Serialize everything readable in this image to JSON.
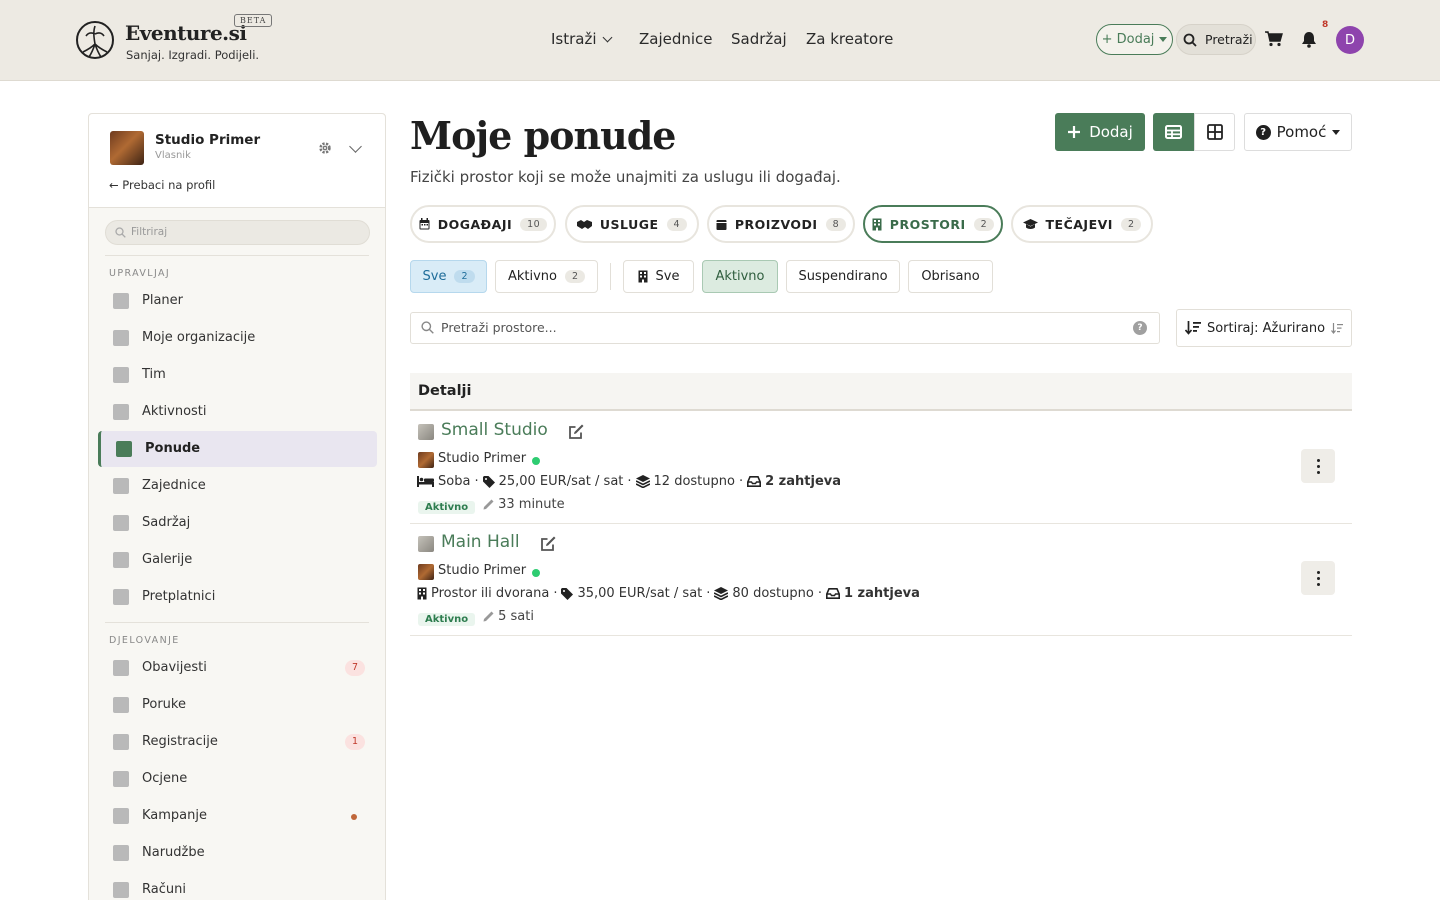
{
  "header": {
    "brand": "Eventure.si",
    "beta": "BETA",
    "tagline": "Sanjaj. Izgradi. Podijeli.",
    "nav": [
      "Istraži",
      "Zajednice",
      "Sadržaj",
      "Za kreatore"
    ],
    "add_label": "+ Dodaj",
    "search_label": "Pretraži",
    "notifications_count": "8",
    "avatar_initial": "D"
  },
  "sidebar": {
    "org_name": "Studio Primer",
    "org_role": "Vlasnik",
    "switch_label": "← Prebaci na profil",
    "filter_placeholder": "Filtriraj",
    "section_manage": "UPRAVLJAJ",
    "section_act": "DJELOVANJE",
    "items_manage": [
      {
        "label": "Planer",
        "icon": "calendar-icon"
      },
      {
        "label": "Moje organizacije",
        "icon": "building-icon"
      },
      {
        "label": "Tim",
        "icon": "team-icon"
      },
      {
        "label": "Aktivnosti",
        "icon": "running-icon"
      },
      {
        "label": "Ponude",
        "icon": "tag-icon",
        "active": true
      },
      {
        "label": "Zajednice",
        "icon": "users-icon"
      },
      {
        "label": "Sadržaj",
        "icon": "newspaper-icon"
      },
      {
        "label": "Galerije",
        "icon": "images-icon"
      },
      {
        "label": "Pretplatnici",
        "icon": "envelope-icon"
      }
    ],
    "items_act": [
      {
        "label": "Obavijesti",
        "icon": "bell-icon",
        "badge": "7"
      },
      {
        "label": "Poruke",
        "icon": "envelope-icon"
      },
      {
        "label": "Registracije",
        "icon": "user-check-icon",
        "badge": "1"
      },
      {
        "label": "Ocjene",
        "icon": "star-icon"
      },
      {
        "label": "Kampanje",
        "icon": "megaphone-icon",
        "dot": true
      },
      {
        "label": "Narudžbe",
        "icon": "shopping-bag-icon"
      },
      {
        "label": "Računi",
        "icon": "invoice-icon"
      }
    ]
  },
  "main": {
    "title": "Moje ponude",
    "subtitle": "Fizički prostor koji se može unajmiti za uslugu ili događaj.",
    "add_label": "Dodaj",
    "help_label": "Pomoć",
    "category_tabs": [
      {
        "label": "DOGAĐAJI",
        "count": "10"
      },
      {
        "label": "USLUGE",
        "count": "4"
      },
      {
        "label": "PROIZVODI",
        "count": "8"
      },
      {
        "label": "PROSTORI",
        "count": "2",
        "active": true
      },
      {
        "label": "TEČAJEVI",
        "count": "2"
      }
    ],
    "filters_left": [
      {
        "label": "Sve",
        "count": "2"
      },
      {
        "label": "Aktivno",
        "count": "2"
      }
    ],
    "filters_right": [
      "Sve",
      "Aktivno",
      "Suspendirano",
      "Obrisano"
    ],
    "search_placeholder": "Pretraži prostore...",
    "sort_label": "Sortiraj: Ažurirano",
    "table_header": "Detalji",
    "rows": [
      {
        "title": "Small Studio",
        "org": "Studio Primer",
        "type": "Soba",
        "price": "25,00 EUR/sat / sat",
        "available": "12 dostupno",
        "requests": "2 zahtjeva",
        "status": "Aktivno",
        "updated": "33 minute"
      },
      {
        "title": "Main Hall",
        "org": "Studio Primer",
        "type": "Prostor ili dvorana",
        "price": "35,00 EUR/sat / sat",
        "available": "80 dostupno",
        "requests": "1 zahtjeva",
        "status": "Aktivno",
        "updated": "5 sati"
      }
    ]
  },
  "colors": {
    "brand_green": "#4a7c59",
    "topbar_bg": "#edeae3",
    "avatar": "#8e44ad",
    "active_dot": "#2ecc71"
  }
}
